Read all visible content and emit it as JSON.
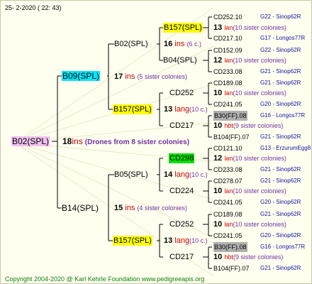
{
  "header_date": "25- 2-2020 ( 22: 43)",
  "copyright": "Copyright 2004-2020 @ Karl Kehrle Foundation    www.pedigreeapis.org",
  "colors": {
    "pink": "#f0c0f0",
    "cyan": "#00e8ff",
    "yellow": "#ffff00",
    "green": "#00e000",
    "gray": "#b0b0b0"
  },
  "root": {
    "label": "B02(SPL)",
    "num": "18",
    "unit": "ins",
    "desc": "(Drones from 8 sister colonies)"
  },
  "sire": {
    "label": "B09(SPL)",
    "num": "17",
    "unit": "ins",
    "desc": "(5 sister colonies)"
  },
  "dam": {
    "label": "B14(SPL)",
    "num": "15",
    "unit": "ins",
    "desc": "(4 sister colonies)"
  },
  "sire_sire": {
    "label": "B02(SPL)",
    "num": "16",
    "unit": "ins",
    "desc": "(6 c.)"
  },
  "sire_dam": {
    "label": "B157(SPL)",
    "num": "13",
    "unit": "lang",
    "desc": "(10 c.)"
  },
  "dam_sire": {
    "label": "B05(SPL)",
    "num": "14",
    "unit": "lang",
    "desc": "(10 c.)"
  },
  "dam_dam": {
    "label": "B157(SPL)",
    "num": "13",
    "unit": "lang",
    "desc": "(10 c.)"
  },
  "g3": [
    {
      "label": "B157(SPL)",
      "num": "13",
      "unit": "lan",
      "desc": "(10 sister colonies)"
    },
    {
      "label": "B04(SPL)",
      "num": "12",
      "unit": "lan",
      "desc": "(10 sister colonies)"
    },
    {
      "label": "CD252",
      "num": "10",
      "unit": "lan",
      "desc": "(10 sister colonies)"
    },
    {
      "label": "CD217",
      "num": "10",
      "unit": "hbt",
      "desc": "(9 sister colonies)"
    },
    {
      "label": "CD298",
      "num": "12",
      "unit": "lan",
      "desc": "(10 sister colonies)"
    },
    {
      "label": "CD224",
      "num": "10",
      "unit": "lan",
      "desc": "(10 sister colonies)"
    },
    {
      "label": "CD252",
      "num": "10",
      "unit": "lan",
      "desc": "(10 sister colonies)"
    },
    {
      "label": "CD217",
      "num": "10",
      "unit": "hbt",
      "desc": "(9 sister colonies)"
    }
  ],
  "g4": [
    {
      "label": "CD252.10",
      "info": "G22 - Sinop62R"
    },
    {
      "label": "CD217.10",
      "info": "G17 - Longos77R"
    },
    {
      "label": "CD152.09",
      "info": "G22 - Sinop62R"
    },
    {
      "label": "CD233.08",
      "info": "G21 - Sinop62R"
    },
    {
      "label": "CD189.08",
      "info": "G21 - Sinop62R"
    },
    {
      "label": "CD241.05",
      "info": "G20 - Sinop62R"
    },
    {
      "label": "B30(FF).08",
      "info": "G16 - Longos77R"
    },
    {
      "label": "B104(FF).07",
      "info": "G21 - Sinop62R"
    },
    {
      "label": "CD121.10",
      "info": "G13 - ErzurumEgg8"
    },
    {
      "label": "CD233.08",
      "info": "G21 - Sinop62R"
    },
    {
      "label": "CD278.07",
      "info": "G21 - Sinop62R"
    },
    {
      "label": "CD241.05",
      "info": "G20 - Sinop62R"
    },
    {
      "label": "CD189.08",
      "info": "G21 - Sinop62R"
    },
    {
      "label": "CD241.05",
      "info": "G20 - Sinop62R"
    },
    {
      "label": "B30(FF).08",
      "info": "G16 - Longos77R"
    },
    {
      "label": "B104(FF).07",
      "info": "G21 - Sinop62R"
    }
  ]
}
